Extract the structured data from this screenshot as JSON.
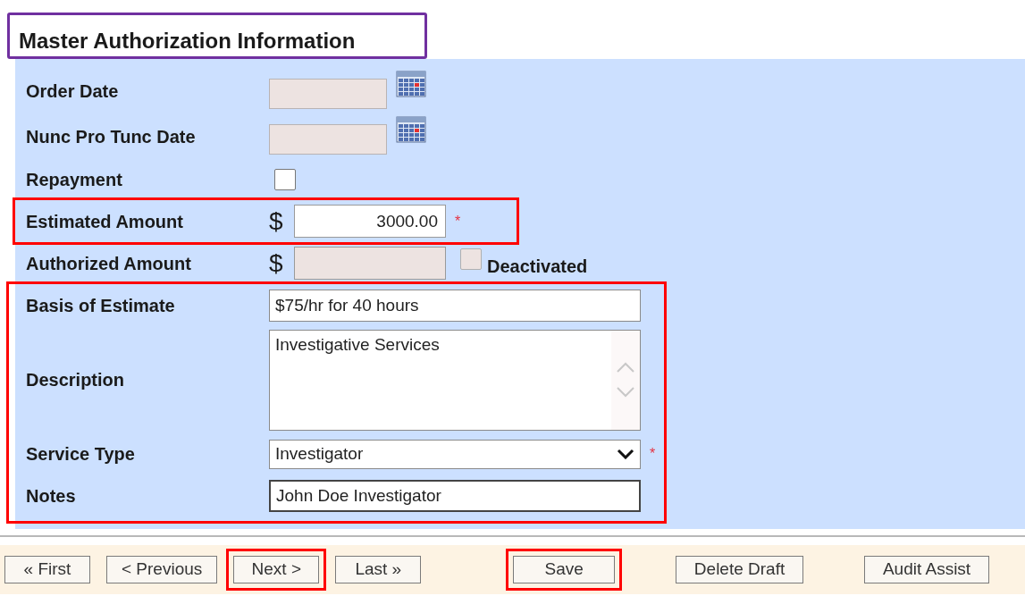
{
  "title": {
    "text": "Master Authorization Information",
    "outlined": true
  },
  "fields": [
    {
      "kind": "date",
      "label": "Order Date",
      "disabled": true,
      "outlined": false
    },
    {
      "kind": "date",
      "label": "Nunc Pro Tunc Date",
      "disabled": true,
      "outlined": false
    },
    {
      "kind": "checkbox",
      "label": "Repayment",
      "checked": false,
      "disabled": false,
      "outlined": false
    },
    {
      "kind": "money",
      "label": "Estimated Amount",
      "currency": "$",
      "value": "3000.00",
      "disabled": false,
      "required_mark": "*",
      "outlined": true
    },
    {
      "kind": "money",
      "label": "Authorized Amount",
      "currency": "$",
      "disabled": true,
      "outlined": false,
      "extra": {
        "label": "Deactivated",
        "checked": false,
        "disabled": true
      }
    },
    {
      "kind": "text",
      "label": "Basis of Estimate",
      "value": "$75/hr for 40 hours",
      "disabled": false,
      "focused": false,
      "outlined": true
    },
    {
      "kind": "textarea",
      "label": "Description",
      "value": "Investigative Services",
      "disabled": false,
      "outlined": true
    },
    {
      "kind": "select",
      "label": "Service Type",
      "value": "Investigator",
      "disabled": false,
      "required_mark": "*",
      "outlined": true
    },
    {
      "kind": "text",
      "label": "Notes",
      "value": "John Doe Investigator",
      "disabled": false,
      "focused": true,
      "outlined": true
    }
  ],
  "nav_buttons": [
    {
      "label": "« First",
      "outlined": false
    },
    {
      "label": "< Previous",
      "outlined": false
    },
    {
      "label": "Next >",
      "outlined": true
    },
    {
      "label": "Last »",
      "outlined": false
    }
  ],
  "action_buttons": [
    {
      "label": "Save",
      "outlined": true
    },
    {
      "label": "Delete Draft",
      "outlined": false
    },
    {
      "label": "Audit Assist",
      "outlined": false
    }
  ]
}
